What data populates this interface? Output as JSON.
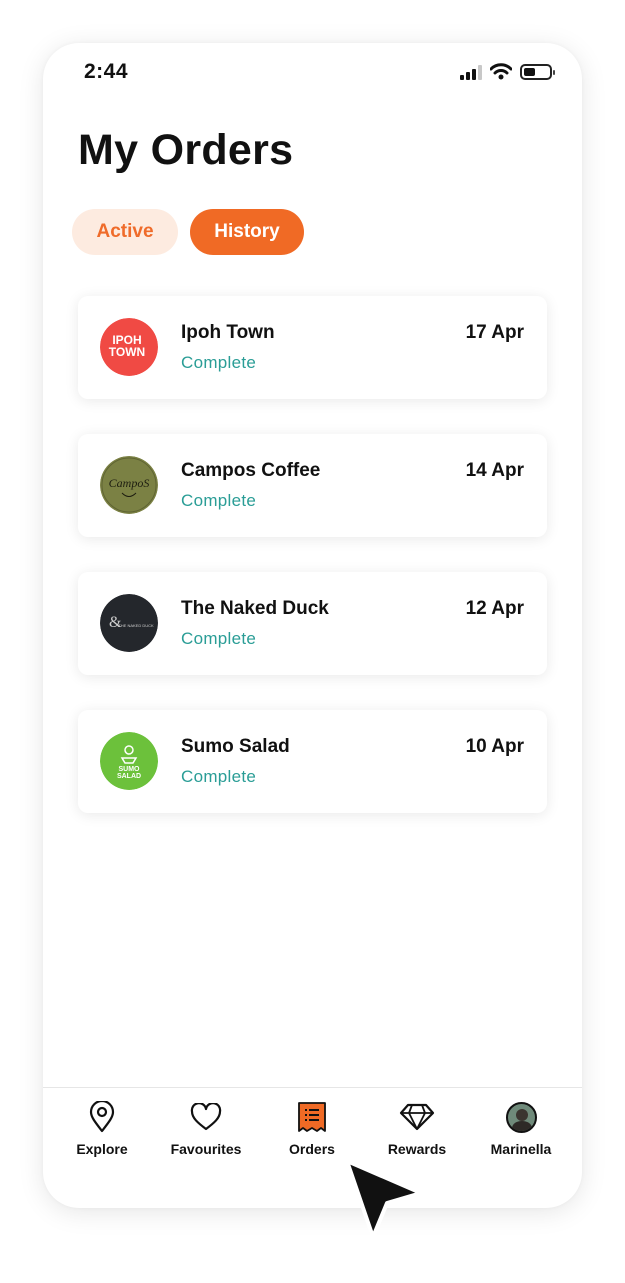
{
  "status_bar": {
    "time": "2:44"
  },
  "header": {
    "title": "My Orders"
  },
  "tabs": [
    {
      "label": "Active",
      "selected": false
    },
    {
      "label": "History",
      "selected": true
    }
  ],
  "orders": [
    {
      "name": "Ipoh Town",
      "status": "Complete",
      "date": "17 Apr",
      "logo_icon": "ipoh-town-logo",
      "logo_text": [
        "IPOH",
        "TOWN"
      ]
    },
    {
      "name": "Campos Coffee",
      "status": "Complete",
      "date": "14 Apr",
      "logo_icon": "campos-coffee-logo",
      "logo_text": [
        "CampoS"
      ]
    },
    {
      "name": "The Naked Duck",
      "status": "Complete",
      "date": "12 Apr",
      "logo_icon": "naked-duck-logo",
      "logo_text": [
        "THE NAKED DUCK"
      ]
    },
    {
      "name": "Sumo Salad",
      "status": "Complete",
      "date": "10 Apr",
      "logo_icon": "sumo-salad-logo",
      "logo_text": [
        "SUMO",
        "SALAD"
      ]
    }
  ],
  "bottom_nav": [
    {
      "label": "Explore",
      "icon": "map-pin-icon"
    },
    {
      "label": "Favourites",
      "icon": "heart-icon"
    },
    {
      "label": "Orders",
      "icon": "receipt-icon",
      "selected": true
    },
    {
      "label": "Rewards",
      "icon": "diamond-icon"
    },
    {
      "label": "Marinella",
      "icon": "avatar"
    }
  ],
  "colors": {
    "accent": "#f06a25",
    "accent_light": "#fdebe0",
    "status_complete": "#2a9d96",
    "ipoh_red": "#f04a44",
    "campos_olive": "#7b8144",
    "naked_duck_dark": "#24272c",
    "sumo_green": "#6cc13b"
  }
}
